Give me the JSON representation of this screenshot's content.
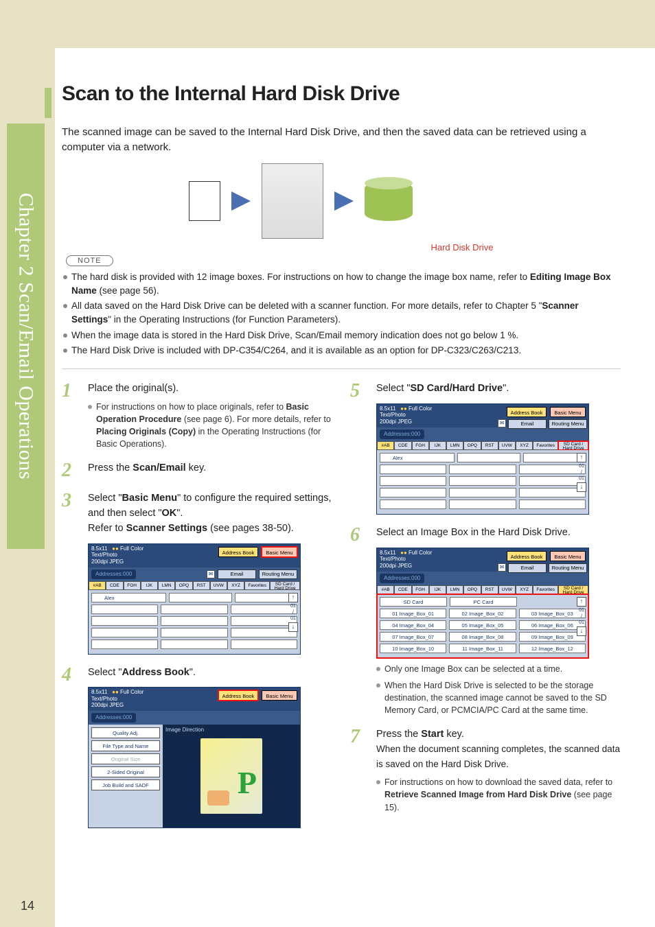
{
  "page_number": "14",
  "chapter_tab": "Chapter 2  Scan/Email Operations",
  "title": "Scan to the Internal Hard Disk Drive",
  "intro": "The scanned image can be saved to the Internal Hard Disk Drive, and then the saved data can be retrieved using a computer via a network.",
  "hdd_label": "Hard Disk Drive",
  "note_badge": "NOTE",
  "notes": [
    {
      "pre": "The hard disk is provided with 12 image boxes. For instructions on how to change the image box name, refer to ",
      "bold": "Editing Image Box Name",
      "post": " (see page 56)."
    },
    {
      "pre": "All data saved on the Hard Disk Drive can be deleted with a scanner function. For more details, refer to Chapter 5 \"",
      "bold": "Scanner Settings",
      "post": "\" in the Operating Instructions (for Function Parameters)."
    },
    {
      "pre": "When the image data is stored in the Hard Disk Drive, Scan/Email memory indication does not go below 1 %.",
      "bold": "",
      "post": ""
    },
    {
      "pre": "The Hard Disk Drive is included with DP-C354/C264, and it is available as an option for DP-C323/C263/C213.",
      "bold": "",
      "post": ""
    }
  ],
  "steps": {
    "s1": {
      "num": "1",
      "text": "Place the original(s).",
      "sub_pre": "For instructions on how to place originals, refer to ",
      "sub_b1": "Basic Operation Procedure",
      "sub_mid": " (see page 6). For more details, refer to ",
      "sub_b2": "Placing Originals (Copy)",
      "sub_post": " in the Operating Instructions (for Basic Operations)."
    },
    "s2": {
      "num": "2",
      "pre": "Press the ",
      "bold": "Scan/Email",
      "post": " key."
    },
    "s3": {
      "num": "3",
      "line_a_pre": "Select \"",
      "line_a_bold": "Basic Menu",
      "line_a_post": "\" to configure the required settings, and then select \"",
      "line_a_bold2": "OK",
      "line_a_post2": "\".",
      "line_b_pre": "Refer to ",
      "line_b_bold": "Scanner Settings",
      "line_b_post": " (see pages 38-50)."
    },
    "s4": {
      "num": "4",
      "pre": "Select \"",
      "bold": "Address Book",
      "post": "\"."
    },
    "s5": {
      "num": "5",
      "pre": "Select \"",
      "bold": "SD Card/Hard Drive",
      "post": "\"."
    },
    "s6": {
      "num": "6",
      "text": "Select an Image Box in the Hard Disk Drive.",
      "sub1": "Only one Image Box can be selected at a time.",
      "sub2": "When the Hard Disk Drive is selected to be the storage destination, the scanned image cannot be saved to the SD Memory Card, or PCMCIA/PC Card at the same time."
    },
    "s7": {
      "num": "7",
      "pre": "Press the ",
      "bold": "Start",
      "post": " key.",
      "line2": "When the document scanning completes, the scanned data is saved on the Hard Disk Drive.",
      "sub_pre": "For instructions on how to download the saved data, refer to ",
      "sub_bold": "Retrieve Scanned Image from Hard Disk Drive",
      "sub_post": " (see page 15)."
    }
  },
  "screen_common": {
    "size": "8.5x11",
    "full_color": "Full Color",
    "text_photo": "Text/Photo",
    "dpi": "200dpi JPEG",
    "addresses": "Addresses:000",
    "address_book": "Address Book",
    "basic_menu": "Basic Menu",
    "email": "Email",
    "routing_menu": "Routing Menu",
    "tabs": [
      "#AB",
      "CDE",
      "FGH",
      "IJK",
      "LMN",
      "OPQ",
      "RST",
      "UVW",
      "XYZ"
    ],
    "favorites": "Favorites",
    "sd_hd": "SD Card / Hard Drive",
    "alex": "Alex",
    "scroll_top": "01",
    "scroll_sep": "/",
    "scroll_bot": "01"
  },
  "screen4": {
    "image_direction": "Image Direction",
    "options": [
      {
        "label": "Quality Adj.",
        "disabled": false
      },
      {
        "label": "File Type and Name",
        "disabled": false
      },
      {
        "label": "Original Size",
        "disabled": true
      },
      {
        "label": "2-Sided Original",
        "disabled": false
      },
      {
        "label": "Job Build and SADF",
        "disabled": false
      }
    ]
  },
  "screen6": {
    "sd_card": "SD Card",
    "pc_card": "PC Card",
    "boxes": [
      "01 Image_Box_01",
      "02 Image_Box_02",
      "03 Image_Box_03",
      "04 Image_Box_04",
      "05 Image_Box_05",
      "06 Image_Box_06",
      "07 Image_Box_07",
      "08 Image_Box_08",
      "09 Image_Box_09",
      "10 Image_Box_10",
      "11 Image_Box_11",
      "12 Image_Box_12"
    ]
  }
}
